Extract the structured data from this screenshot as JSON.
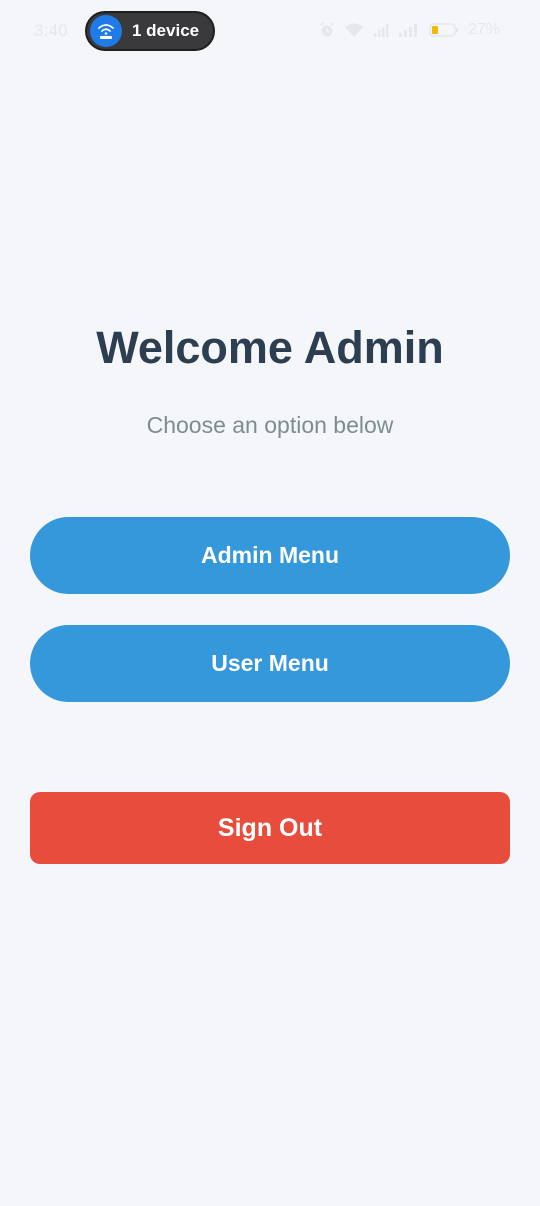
{
  "status_bar": {
    "time": "3:40",
    "hotspot_label": "1 device",
    "battery_percent": "27%",
    "icons": [
      "hotspot-icon",
      "alarm-icon",
      "wifi-icon",
      "signal-icon",
      "signal-icon",
      "battery-icon"
    ],
    "colors": {
      "pill_bg": "#3a3a3c",
      "hotspot_blue": "#1e7be8",
      "battery_low": "#f5b800"
    }
  },
  "main": {
    "title": "Welcome Admin",
    "subtitle": "Choose an option below",
    "admin_menu_label": "Admin Menu",
    "user_menu_label": "User Menu",
    "sign_out_label": "Sign Out"
  },
  "colors": {
    "background": "#f4f6f9",
    "title": "#2c3e50",
    "subtitle": "#7f8c8d",
    "primary_button": "#3498db",
    "danger_button": "#e74c3c"
  }
}
